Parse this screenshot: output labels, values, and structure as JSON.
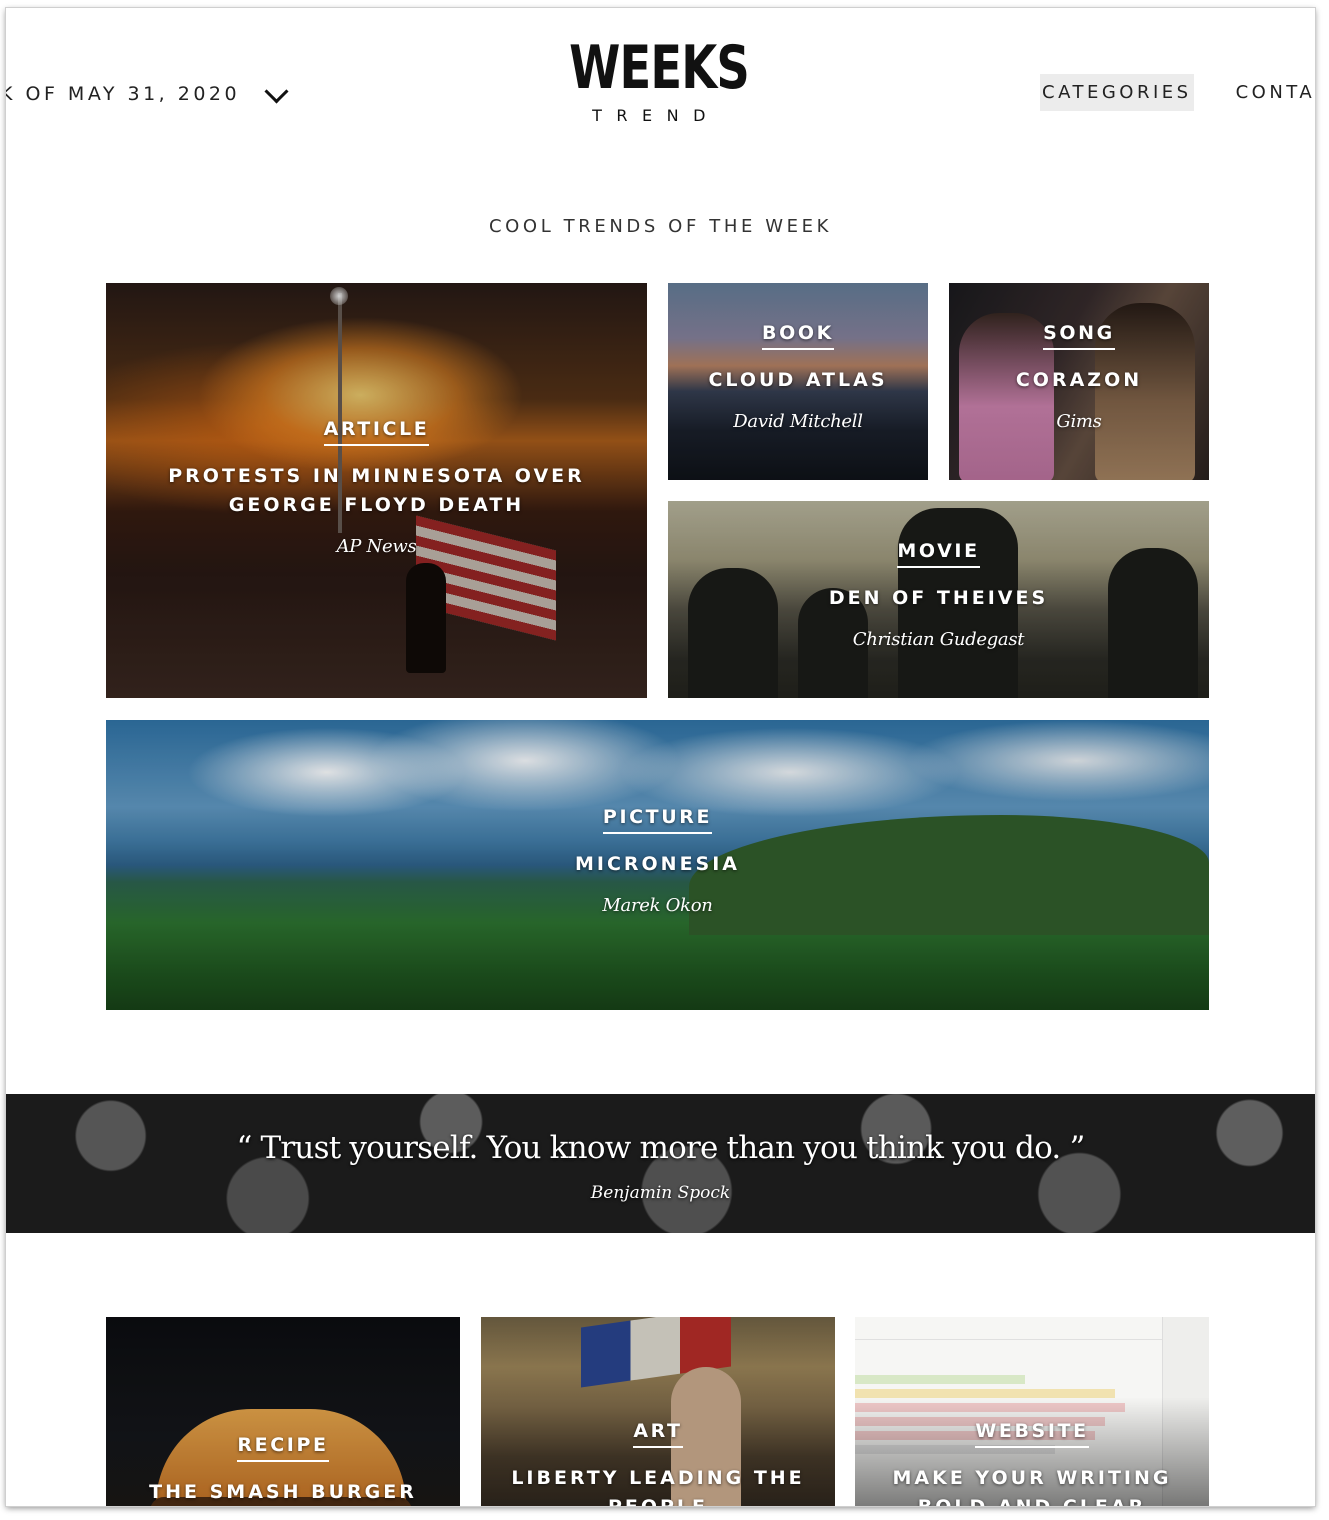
{
  "header": {
    "date_label": "K OF MAY 31, 2020",
    "logo_main": "WEEKS",
    "logo_sub": "TREND",
    "nav": [
      {
        "label": "CATEGORIES",
        "active": true
      },
      {
        "label": "CONTA",
        "active": false
      }
    ]
  },
  "section_title": "COOL TRENDS OF THE WEEK",
  "featured": {
    "article": {
      "category": "ARTICLE",
      "title": "PROTESTS IN MINNESOTA OVER GEORGE FLOYD DEATH",
      "author": "AP News"
    },
    "book": {
      "category": "BOOK",
      "title": "CLOUD ATLAS",
      "author": "David Mitchell"
    },
    "song": {
      "category": "SONG",
      "title": "CORAZON",
      "author": "Gims"
    },
    "movie": {
      "category": "MOVIE",
      "title": "DEN OF THEIVES",
      "author": "Christian Gudegast"
    },
    "picture": {
      "category": "PICTURE",
      "title": "MICRONESIA",
      "author": "Marek Okon"
    }
  },
  "quote": {
    "text": "“ Trust yourself. You know more than you think you do. ”",
    "author": "Benjamin Spock"
  },
  "more": {
    "recipe": {
      "category": "RECIPE",
      "title": "THE SMASH BURGER"
    },
    "art": {
      "category": "ART",
      "title": "LIBERTY LEADING THE PEOPLE"
    },
    "website": {
      "category": "WEBSITE",
      "title": "MAKE YOUR WRITING BOLD AND CLEAR"
    }
  }
}
